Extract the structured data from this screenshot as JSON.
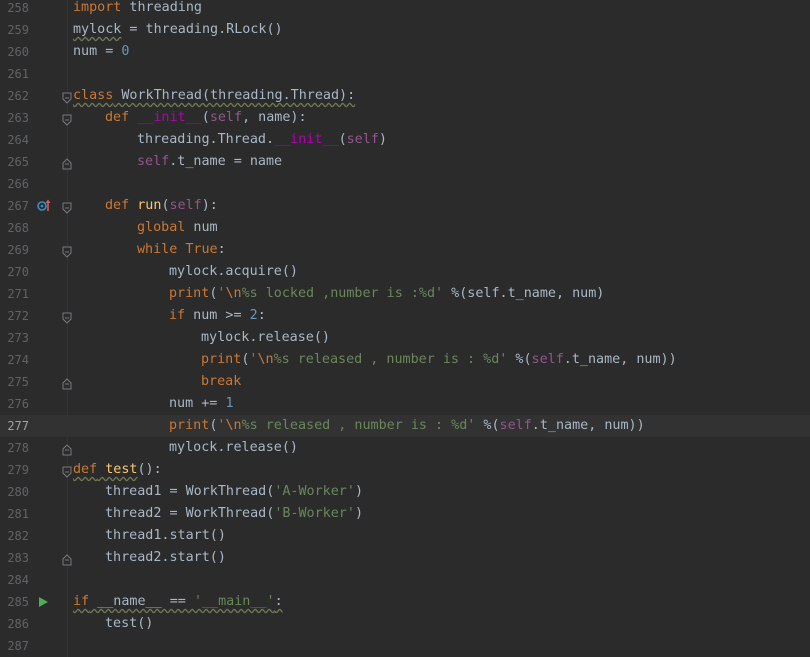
{
  "editor": {
    "lines": [
      {
        "no": "258",
        "indent": 0,
        "tokens": [
          [
            "kw",
            "import"
          ],
          [
            "p",
            " threading"
          ]
        ]
      },
      {
        "no": "259",
        "indent": 0,
        "tokens": [
          [
            "pw",
            "mylock"
          ],
          [
            "p",
            " = threading.RLock()"
          ]
        ]
      },
      {
        "no": "260",
        "indent": 0,
        "tokens": [
          [
            "p",
            "num = "
          ],
          [
            "num",
            "0"
          ]
        ]
      },
      {
        "no": "261",
        "indent": 0,
        "tokens": []
      },
      {
        "no": "262",
        "indent": 0,
        "fold": "open",
        "tokens": [
          [
            "kww",
            "class"
          ],
          [
            "pw",
            " WorkThread(threading.Thread):"
          ]
        ]
      },
      {
        "no": "263",
        "indent": 1,
        "fold": "open",
        "tokens": [
          [
            "kw",
            "def "
          ],
          [
            "dunder",
            "__init__"
          ],
          [
            "p",
            "("
          ],
          [
            "self",
            "self"
          ],
          [
            "p",
            ", name):"
          ]
        ]
      },
      {
        "no": "264",
        "indent": 2,
        "tokens": [
          [
            "p",
            "threading.Thread."
          ],
          [
            "dunder",
            "__init__"
          ],
          [
            "p",
            "("
          ],
          [
            "self",
            "self"
          ],
          [
            "p",
            ")"
          ]
        ]
      },
      {
        "no": "265",
        "indent": 2,
        "fold": "close",
        "tokens": [
          [
            "self",
            "self"
          ],
          [
            "p",
            ".t_name = name"
          ]
        ]
      },
      {
        "no": "266",
        "indent": 0,
        "tokens": []
      },
      {
        "no": "267",
        "indent": 1,
        "fold": "open",
        "mark": "override",
        "tokens": [
          [
            "kw",
            "def "
          ],
          [
            "fn",
            "run"
          ],
          [
            "p",
            "("
          ],
          [
            "self",
            "self"
          ],
          [
            "p",
            "):"
          ]
        ]
      },
      {
        "no": "268",
        "indent": 2,
        "tokens": [
          [
            "kw",
            "global"
          ],
          [
            "p",
            " num"
          ]
        ]
      },
      {
        "no": "269",
        "indent": 2,
        "fold": "open",
        "tokens": [
          [
            "kw",
            "while True"
          ],
          [
            "p",
            ":"
          ]
        ]
      },
      {
        "no": "270",
        "indent": 3,
        "tokens": [
          [
            "p",
            "mylock.acquire()"
          ]
        ]
      },
      {
        "no": "271",
        "indent": 3,
        "tokens": [
          [
            "kw",
            "print"
          ],
          [
            "p",
            "("
          ],
          [
            "str",
            "'"
          ],
          [
            "esc",
            "\\n"
          ],
          [
            "str",
            "%s locked ,number is :%d'"
          ],
          [
            "p",
            " %(self.t_name, num)"
          ]
        ]
      },
      {
        "no": "272",
        "indent": 3,
        "fold": "open",
        "tokens": [
          [
            "kw",
            "if"
          ],
          [
            "p",
            " num >= "
          ],
          [
            "num",
            "2"
          ],
          [
            "p",
            ":"
          ]
        ]
      },
      {
        "no": "273",
        "indent": 4,
        "tokens": [
          [
            "p",
            "mylock.release()"
          ]
        ]
      },
      {
        "no": "274",
        "indent": 4,
        "tokens": [
          [
            "kw",
            "print"
          ],
          [
            "p",
            "("
          ],
          [
            "str",
            "'"
          ],
          [
            "esc",
            "\\n"
          ],
          [
            "str",
            "%s released , number is : %d'"
          ],
          [
            "p",
            " %("
          ],
          [
            "self",
            "self"
          ],
          [
            "p",
            ".t_name, num))"
          ]
        ]
      },
      {
        "no": "275",
        "indent": 4,
        "fold": "close",
        "tokens": [
          [
            "kw",
            "break"
          ]
        ]
      },
      {
        "no": "276",
        "indent": 3,
        "tokens": [
          [
            "p",
            "num += "
          ],
          [
            "num",
            "1"
          ]
        ]
      },
      {
        "no": "277",
        "indent": 3,
        "current": true,
        "tokens": [
          [
            "kw",
            "print"
          ],
          [
            "p",
            "("
          ],
          [
            "str",
            "'"
          ],
          [
            "esc",
            "\\n"
          ],
          [
            "str",
            "%s released , number is : %d'"
          ],
          [
            "p",
            " %("
          ],
          [
            "self",
            "self"
          ],
          [
            "p",
            ".t_name, num))"
          ]
        ]
      },
      {
        "no": "278",
        "indent": 3,
        "fold": "close",
        "tokens": [
          [
            "p",
            "mylock.release()"
          ]
        ]
      },
      {
        "no": "279",
        "indent": 0,
        "fold": "open",
        "tokens": [
          [
            "kww",
            "def"
          ],
          [
            "fnw",
            " test"
          ],
          [
            "p",
            "():"
          ]
        ]
      },
      {
        "no": "280",
        "indent": 1,
        "tokens": [
          [
            "p",
            "thread1 = WorkThread("
          ],
          [
            "str",
            "'A-Worker'"
          ],
          [
            "p",
            ")"
          ]
        ]
      },
      {
        "no": "281",
        "indent": 1,
        "tokens": [
          [
            "p",
            "thread2 = WorkThread("
          ],
          [
            "str",
            "'B-Worker'"
          ],
          [
            "p",
            ")"
          ]
        ]
      },
      {
        "no": "282",
        "indent": 1,
        "tokens": [
          [
            "p",
            "thread1.start()"
          ]
        ]
      },
      {
        "no": "283",
        "indent": 1,
        "fold": "close",
        "tokens": [
          [
            "p",
            "thread2.start()"
          ]
        ]
      },
      {
        "no": "284",
        "indent": 0,
        "tokens": []
      },
      {
        "no": "285",
        "indent": 0,
        "mark": "run",
        "tokens": [
          [
            "kww",
            "if"
          ],
          [
            "pw",
            " __name__ == "
          ],
          [
            "strw",
            "'__main__'"
          ],
          [
            "pw",
            ":"
          ]
        ]
      },
      {
        "no": "286",
        "indent": 1,
        "tokens": [
          [
            "p",
            "test()"
          ]
        ]
      },
      {
        "no": "287",
        "indent": 0,
        "tokens": []
      }
    ],
    "colors": {
      "background": "#2b2b2b",
      "keyword": "#cc7832",
      "string": "#6a8759",
      "number": "#6897bb",
      "self": "#94558d",
      "function": "#ffc66d",
      "text": "#a9b7c6",
      "run_icon": "#4caf50"
    }
  }
}
